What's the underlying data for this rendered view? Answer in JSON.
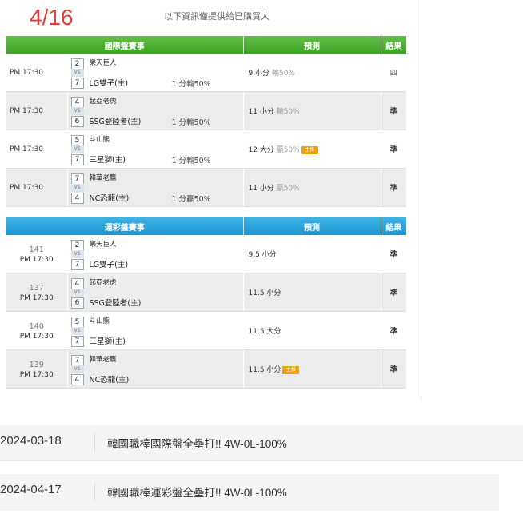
{
  "header": {
    "date": "4/16",
    "notice": "以下資訊僅提供給已購買人"
  },
  "intl": {
    "headers": [
      "國際盤賽事",
      "預測",
      "結果"
    ],
    "rows": [
      {
        "time": "PM 17:30",
        "score_top": "2",
        "vs": "VS",
        "score_bot": "7",
        "team_top": "樂天巨人",
        "team_bot": "LG雙子(主)",
        "handicap": "1 分輸50%",
        "pred": "9 小分",
        "pred_note": "輸50%",
        "tag": "",
        "result": "四"
      },
      {
        "time": "PM 17:30",
        "score_top": "4",
        "vs": "VS",
        "score_bot": "6",
        "team_top": "起亞老虎",
        "team_bot": "SSG登陸者(主)",
        "handicap": "1 分輸50%",
        "pred": "11 小分",
        "pred_note": "輸50%",
        "tag": "",
        "result": "準"
      },
      {
        "time": "PM 17:30",
        "score_top": "5",
        "vs": "VS",
        "score_bot": "7",
        "team_top": "斗山熊",
        "team_bot": "三星獅(主)",
        "handicap": "1 分輸50%",
        "pred": "12 大分",
        "pred_note": "贏50%",
        "tag": "主推",
        "result": "準"
      },
      {
        "time": "PM 17:30",
        "score_top": "7",
        "vs": "VS",
        "score_bot": "4",
        "team_top": "韓華老鷹",
        "team_bot": "NC恐龍(主)",
        "handicap": "1 分贏50%",
        "pred": "11 小分",
        "pred_note": "贏50%",
        "tag": "",
        "result": "準"
      }
    ]
  },
  "lottery": {
    "headers": [
      "運彩盤賽事",
      "預測",
      "結果"
    ],
    "rows": [
      {
        "num": "141",
        "time": "PM 17:30",
        "score_top": "2",
        "vs": "VS",
        "score_bot": "7",
        "team_top": "樂天巨人",
        "team_bot": "LG雙子(主)",
        "pred": "9.5 小分",
        "tag": "",
        "result": "準"
      },
      {
        "num": "137",
        "time": "PM 17:30",
        "score_top": "4",
        "vs": "VS",
        "score_bot": "6",
        "team_top": "起亞老虎",
        "team_bot": "SSG登陸者(主)",
        "pred": "11.5 小分",
        "tag": "",
        "result": "準"
      },
      {
        "num": "140",
        "time": "PM 17:30",
        "score_top": "5",
        "vs": "VS",
        "score_bot": "7",
        "team_top": "斗山熊",
        "team_bot": "三星獅(主)",
        "pred": "11.5 大分",
        "tag": "",
        "result": "準"
      },
      {
        "num": "139",
        "time": "PM 17:30",
        "score_top": "7",
        "vs": "VS",
        "score_bot": "4",
        "team_top": "韓華老鷹",
        "team_bot": "NC恐龍(主)",
        "pred": "11.5 小分",
        "tag": "主推",
        "result": "準"
      }
    ]
  },
  "records": [
    {
      "date": "2024-03-18",
      "title": "韓國職棒國際盤全壘打!! 4W-0L-100%"
    },
    {
      "date": "2024-04-17",
      "title": "韓國職棒運彩盤全壘打!! 4W-0L-100%"
    }
  ]
}
